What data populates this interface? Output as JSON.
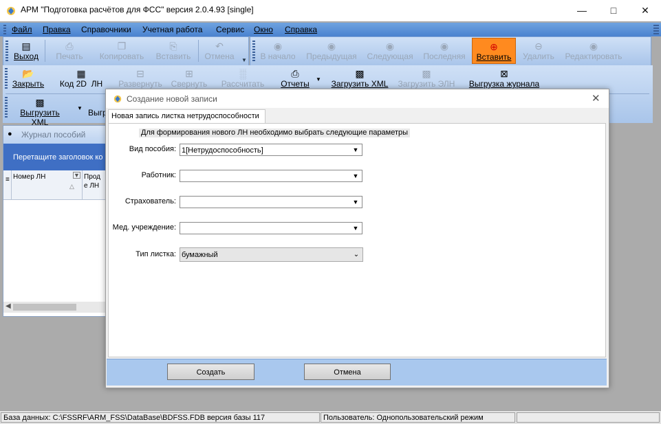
{
  "window": {
    "title": "АРМ \"Подготовка расчётов для ФСС\"   версия 2.0.4.93 [single]",
    "minimize_icon": "minimize-icon",
    "maximize_icon": "maximize-icon",
    "close_icon": "close-icon"
  },
  "menu": [
    "Файл",
    "Правка",
    "Справочники",
    "Учетная работа",
    "Сервис",
    "Окно",
    "Справка"
  ],
  "toolbar1": {
    "exit": "Выход",
    "print": "Печать",
    "copy": "Копировать",
    "paste": "Вставить",
    "undo": "Отмена"
  },
  "nav_toolbar": {
    "first": "В начало",
    "prev": "Предыдущая",
    "next": "Следующая",
    "last": "Последняя",
    "insert": "Вставить",
    "delete": "Удалить",
    "edit": "Редактировать"
  },
  "toolbar2": {
    "close": "Закрыть",
    "code2d": "Код 2D",
    "ln": "ЛН",
    "expand": "Развернуть",
    "collapse": "Свернуть",
    "calculate": "Рассчитать",
    "reports": "Отчеты",
    "load_xml": "Загрузить XML",
    "load_eln": "Загрузить ЭЛН",
    "export_journal": "Выгрузка журнала",
    "export_xml": "Выгрузить XML",
    "export_cut": "Выгр"
  },
  "journal": {
    "title": "Журнал пособий",
    "drag_hint": "Перетащите заголовок ко",
    "col1": "Номер ЛН",
    "col2_line1": "Прод",
    "col2_line2": "е ЛН"
  },
  "dialog": {
    "title": "Создание новой записи",
    "tab": "Новая запись листка нетрудоспособности",
    "hint": "Для формирования нового ЛН необходимо выбрать следующие параметры",
    "fields": {
      "benefit_type_label": "Вид пособия:",
      "benefit_type_value": "1[Нетрудоспособность]",
      "worker_label": "Работник:",
      "worker_value": "",
      "insurer_label": "Страхователь:",
      "insurer_value": "",
      "med_label": "Мед. учреждение:",
      "med_value": "",
      "sheet_type_label": "Тип листка:",
      "sheet_type_value": "бумажный"
    },
    "create_button": "Создать",
    "cancel_button": "Отмена"
  },
  "statusbar": {
    "db": "База данных: C:\\FSSRF\\ARM_FSS\\DataBase\\BDFSS.FDB  версия базы 117",
    "user": "Пользователь: Однопользовательский режим"
  },
  "colors": {
    "accent_active_button": "#ff8a1f",
    "menu_bar": "#5a8fd8",
    "dialog_footer": "#a9c8ee"
  }
}
